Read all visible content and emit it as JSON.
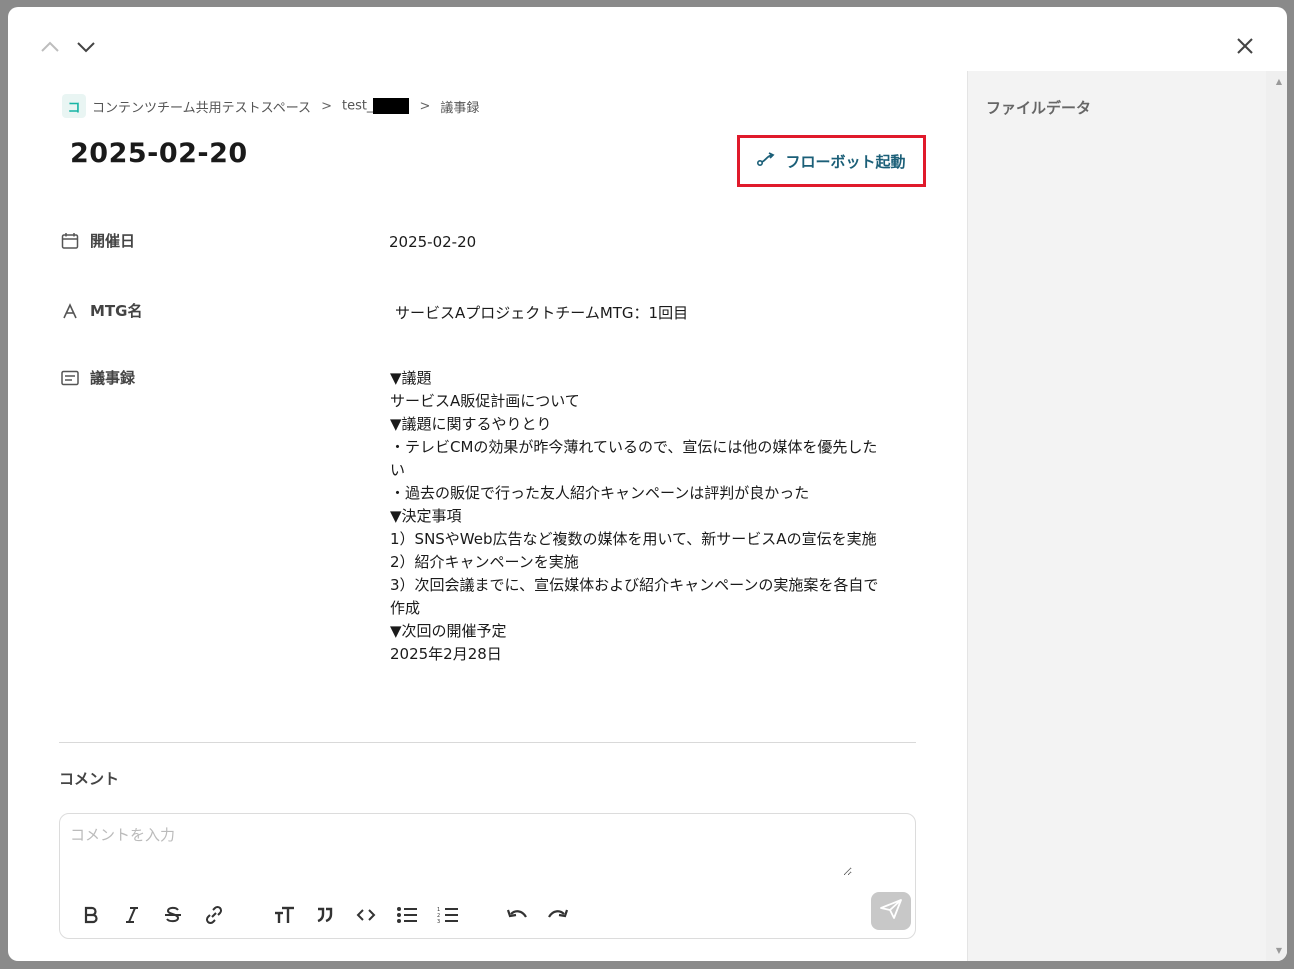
{
  "breadcrumb": {
    "space_badge": "コ",
    "space_name": "コンテンツチーム共用テストスペース",
    "sep": ">",
    "folder": "test_",
    "current": "議事録"
  },
  "record": {
    "title": "2025-02-20",
    "flowbot_button": "フローボット起動"
  },
  "fields": {
    "date_label": "開催日",
    "date_value": "2025-02-20",
    "mtg_label": "MTG名",
    "mtg_value": "サービスAプロジェクトチームMTG：1回目",
    "minutes_label": "議事録",
    "minutes_lines": [
      "▼議題",
      "サービスA販促計画について",
      "▼議題に関するやりとり",
      "・テレビCMの効果が昨今薄れているので、宣伝には他の媒体を優先した",
      "い",
      "・過去の販促で行った友人紹介キャンペーンは評判が良かった",
      "▼決定事項",
      "1）SNSやWeb広告など複数の媒体を用いて、新サービスAの宣伝を実施",
      "2）紹介キャンペーンを実施",
      "3）次回会議までに、宣伝媒体および紹介キャンペーンの実施案を各自で",
      "作成",
      "▼次回の開催予定",
      "2025年2月28日"
    ]
  },
  "comment": {
    "label": "コメント",
    "placeholder": "コメントを入力",
    "value": ""
  },
  "right_panel": {
    "title": "ファイルデータ"
  },
  "icons": {
    "prev": "chevron-up-icon",
    "next": "chevron-down-icon",
    "close": "close-icon",
    "flowbot": "flow-icon",
    "date": "calendar-icon",
    "mtg": "text-a-icon",
    "minutes": "text-box-icon",
    "toolbar": [
      "bold-icon",
      "italic-icon",
      "strikethrough-icon",
      "link-icon",
      "text-size-icon",
      "quote-icon",
      "code-icon",
      "bullet-list-icon",
      "numbered-list-icon",
      "undo-icon",
      "redo-icon"
    ],
    "send": "send-icon"
  },
  "colors": {
    "accent_border": "#e01a2b",
    "button_text": "#1b5f78",
    "badge_text": "#19b5a5"
  }
}
